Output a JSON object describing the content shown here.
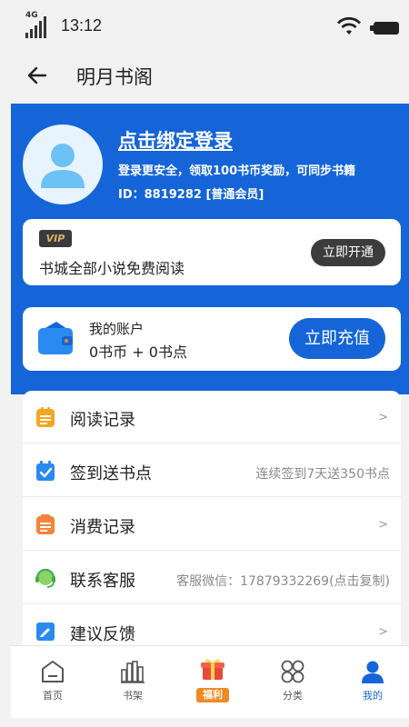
{
  "status": {
    "network": "4G",
    "time": "13:12"
  },
  "nav": {
    "title": "明月书阁"
  },
  "profile": {
    "login_title": "点击绑定登录",
    "login_subtitle": "登录更安全，领取100书币奖励，可同步书籍",
    "member_id": "ID：8819282 [普通会员]"
  },
  "vip": {
    "badge": "VIP",
    "description": "书城全部小说免费阅读",
    "button": "立即开通"
  },
  "account": {
    "title": "我的账户",
    "balance": "0书币 + 0书点",
    "button": "立即充值"
  },
  "menu": {
    "items": [
      {
        "label": "阅读记录",
        "hint": ">"
      },
      {
        "label": "签到送书点",
        "hint": "连续签到7天送350书点"
      },
      {
        "label": "消费记录",
        "hint": ">"
      },
      {
        "label": "联系客服",
        "hint": "客服微信：17879332269(点击复制)"
      },
      {
        "label": "建议反馈",
        "hint": ">"
      }
    ]
  },
  "tabs": [
    {
      "label": "首页"
    },
    {
      "label": "书架"
    },
    {
      "label": "福利"
    },
    {
      "label": "分类"
    },
    {
      "label": "我的"
    }
  ],
  "colors": {
    "brand_blue": "#1565d8",
    "accent_orange": "#f08a24",
    "text_dark": "#222222"
  }
}
